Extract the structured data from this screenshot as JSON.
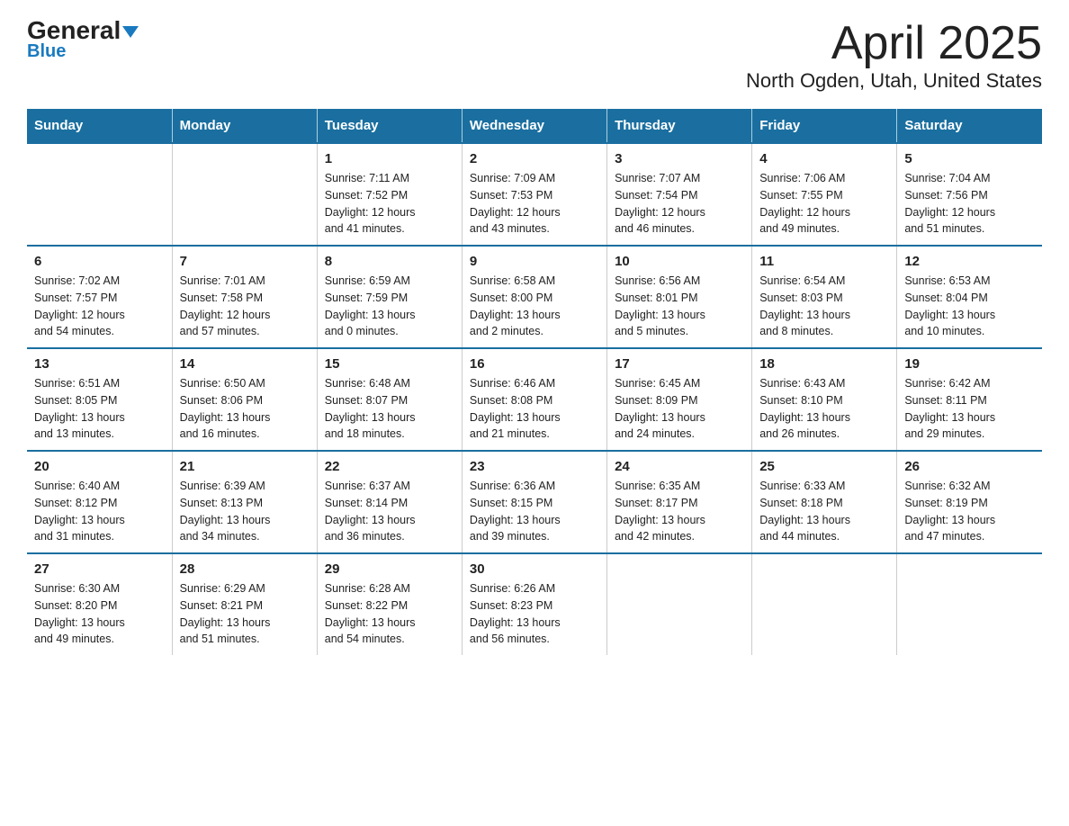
{
  "header": {
    "logo_main": "General",
    "logo_sub": "Blue",
    "title": "April 2025",
    "subtitle": "North Ogden, Utah, United States"
  },
  "days_of_week": [
    "Sunday",
    "Monday",
    "Tuesday",
    "Wednesday",
    "Thursday",
    "Friday",
    "Saturday"
  ],
  "weeks": [
    [
      {
        "day": "",
        "info": ""
      },
      {
        "day": "",
        "info": ""
      },
      {
        "day": "1",
        "info": "Sunrise: 7:11 AM\nSunset: 7:52 PM\nDaylight: 12 hours\nand 41 minutes."
      },
      {
        "day": "2",
        "info": "Sunrise: 7:09 AM\nSunset: 7:53 PM\nDaylight: 12 hours\nand 43 minutes."
      },
      {
        "day": "3",
        "info": "Sunrise: 7:07 AM\nSunset: 7:54 PM\nDaylight: 12 hours\nand 46 minutes."
      },
      {
        "day": "4",
        "info": "Sunrise: 7:06 AM\nSunset: 7:55 PM\nDaylight: 12 hours\nand 49 minutes."
      },
      {
        "day": "5",
        "info": "Sunrise: 7:04 AM\nSunset: 7:56 PM\nDaylight: 12 hours\nand 51 minutes."
      }
    ],
    [
      {
        "day": "6",
        "info": "Sunrise: 7:02 AM\nSunset: 7:57 PM\nDaylight: 12 hours\nand 54 minutes."
      },
      {
        "day": "7",
        "info": "Sunrise: 7:01 AM\nSunset: 7:58 PM\nDaylight: 12 hours\nand 57 minutes."
      },
      {
        "day": "8",
        "info": "Sunrise: 6:59 AM\nSunset: 7:59 PM\nDaylight: 13 hours\nand 0 minutes."
      },
      {
        "day": "9",
        "info": "Sunrise: 6:58 AM\nSunset: 8:00 PM\nDaylight: 13 hours\nand 2 minutes."
      },
      {
        "day": "10",
        "info": "Sunrise: 6:56 AM\nSunset: 8:01 PM\nDaylight: 13 hours\nand 5 minutes."
      },
      {
        "day": "11",
        "info": "Sunrise: 6:54 AM\nSunset: 8:03 PM\nDaylight: 13 hours\nand 8 minutes."
      },
      {
        "day": "12",
        "info": "Sunrise: 6:53 AM\nSunset: 8:04 PM\nDaylight: 13 hours\nand 10 minutes."
      }
    ],
    [
      {
        "day": "13",
        "info": "Sunrise: 6:51 AM\nSunset: 8:05 PM\nDaylight: 13 hours\nand 13 minutes."
      },
      {
        "day": "14",
        "info": "Sunrise: 6:50 AM\nSunset: 8:06 PM\nDaylight: 13 hours\nand 16 minutes."
      },
      {
        "day": "15",
        "info": "Sunrise: 6:48 AM\nSunset: 8:07 PM\nDaylight: 13 hours\nand 18 minutes."
      },
      {
        "day": "16",
        "info": "Sunrise: 6:46 AM\nSunset: 8:08 PM\nDaylight: 13 hours\nand 21 minutes."
      },
      {
        "day": "17",
        "info": "Sunrise: 6:45 AM\nSunset: 8:09 PM\nDaylight: 13 hours\nand 24 minutes."
      },
      {
        "day": "18",
        "info": "Sunrise: 6:43 AM\nSunset: 8:10 PM\nDaylight: 13 hours\nand 26 minutes."
      },
      {
        "day": "19",
        "info": "Sunrise: 6:42 AM\nSunset: 8:11 PM\nDaylight: 13 hours\nand 29 minutes."
      }
    ],
    [
      {
        "day": "20",
        "info": "Sunrise: 6:40 AM\nSunset: 8:12 PM\nDaylight: 13 hours\nand 31 minutes."
      },
      {
        "day": "21",
        "info": "Sunrise: 6:39 AM\nSunset: 8:13 PM\nDaylight: 13 hours\nand 34 minutes."
      },
      {
        "day": "22",
        "info": "Sunrise: 6:37 AM\nSunset: 8:14 PM\nDaylight: 13 hours\nand 36 minutes."
      },
      {
        "day": "23",
        "info": "Sunrise: 6:36 AM\nSunset: 8:15 PM\nDaylight: 13 hours\nand 39 minutes."
      },
      {
        "day": "24",
        "info": "Sunrise: 6:35 AM\nSunset: 8:17 PM\nDaylight: 13 hours\nand 42 minutes."
      },
      {
        "day": "25",
        "info": "Sunrise: 6:33 AM\nSunset: 8:18 PM\nDaylight: 13 hours\nand 44 minutes."
      },
      {
        "day": "26",
        "info": "Sunrise: 6:32 AM\nSunset: 8:19 PM\nDaylight: 13 hours\nand 47 minutes."
      }
    ],
    [
      {
        "day": "27",
        "info": "Sunrise: 6:30 AM\nSunset: 8:20 PM\nDaylight: 13 hours\nand 49 minutes."
      },
      {
        "day": "28",
        "info": "Sunrise: 6:29 AM\nSunset: 8:21 PM\nDaylight: 13 hours\nand 51 minutes."
      },
      {
        "day": "29",
        "info": "Sunrise: 6:28 AM\nSunset: 8:22 PM\nDaylight: 13 hours\nand 54 minutes."
      },
      {
        "day": "30",
        "info": "Sunrise: 6:26 AM\nSunset: 8:23 PM\nDaylight: 13 hours\nand 56 minutes."
      },
      {
        "day": "",
        "info": ""
      },
      {
        "day": "",
        "info": ""
      },
      {
        "day": "",
        "info": ""
      }
    ]
  ]
}
